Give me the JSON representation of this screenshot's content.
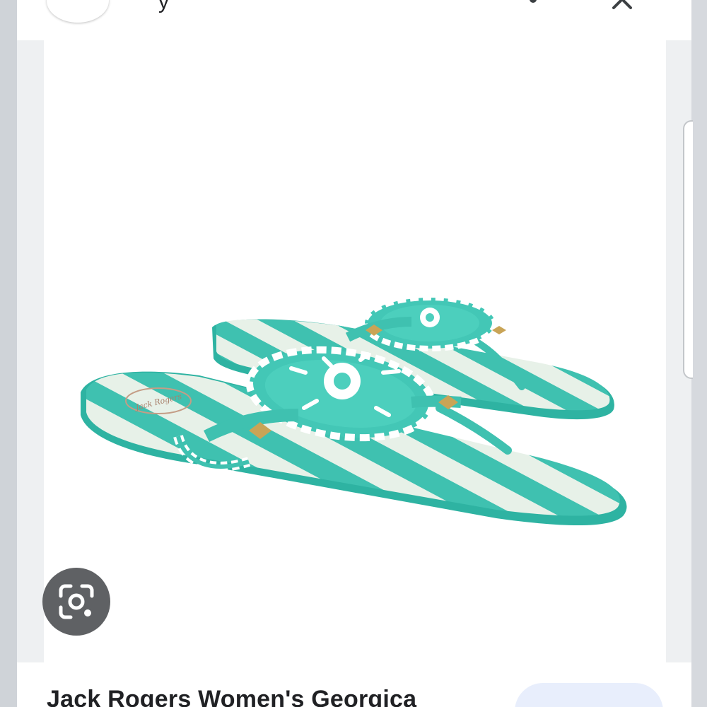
{
  "header": {
    "title": "y",
    "logo_colors": [
      "#4285f4",
      "#ea4335",
      "#fbbc05",
      "#34a853"
    ]
  },
  "image": {
    "brand_stamp": "Jack Rogers",
    "colors": {
      "sandal": "#3fc1b0",
      "stripe": "#e7f1e8",
      "whipstitch": "#ffffff",
      "stud": "#c9a456"
    }
  },
  "product": {
    "title": "Jack Rogers Women's Georgica"
  },
  "icons": {
    "lens": "google-lens-icon",
    "more": "more-vert-icon",
    "close": "close-icon"
  }
}
